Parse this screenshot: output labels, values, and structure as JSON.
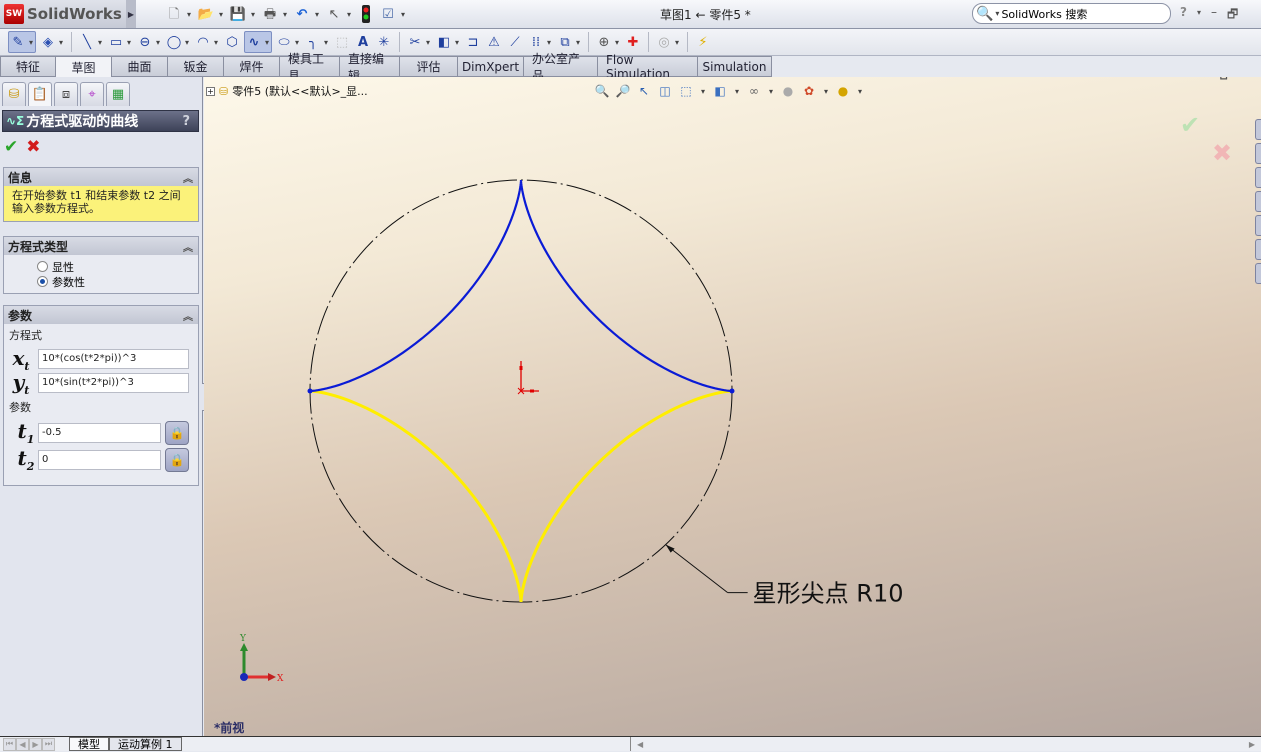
{
  "app": {
    "logo_mark": "SW",
    "logo_text": "SolidWorks",
    "document_title": "草图1 ← 零件5 *",
    "search_placeholder": "SolidWorks 搜索"
  },
  "quick_access": [
    {
      "name": "new-document-icon",
      "glyph": "🗋"
    },
    {
      "name": "open-folder-icon",
      "glyph": "📂"
    },
    {
      "name": "save-icon",
      "glyph": "💾"
    },
    {
      "name": "print-icon",
      "glyph": "🖶"
    },
    {
      "name": "undo-icon",
      "glyph": "↶"
    },
    {
      "name": "select-pointer-icon",
      "glyph": "↖"
    },
    {
      "name": "rebuild-traffic-light-icon",
      "glyph": "●"
    },
    {
      "name": "options-checklist-icon",
      "glyph": "☑"
    }
  ],
  "window_controls": {
    "help": "?",
    "minimize": "–",
    "restore": "🗗"
  },
  "sketch_toolbar": [
    {
      "name": "exit-sketch-icon",
      "glyph": "✎",
      "active": true
    },
    {
      "name": "smart-dimension-icon",
      "glyph": "◈"
    },
    {
      "name": "line-icon",
      "glyph": "╲"
    },
    {
      "name": "rectangle-icon",
      "glyph": "▭"
    },
    {
      "name": "slot-icon",
      "glyph": "⊖"
    },
    {
      "name": "circle-icon",
      "glyph": "◯"
    },
    {
      "name": "arc-icon",
      "glyph": "◠"
    },
    {
      "name": "polygon-icon",
      "glyph": "⬡"
    },
    {
      "name": "spline-icon",
      "glyph": "∿",
      "active": true
    },
    {
      "name": "ellipse-icon",
      "glyph": "⬭"
    },
    {
      "name": "fillet-icon",
      "glyph": "╮"
    },
    {
      "name": "plane-icon",
      "glyph": "⬚"
    },
    {
      "name": "text-icon",
      "glyph": "A"
    },
    {
      "name": "point-icon",
      "glyph": "✳"
    },
    {
      "name": "trim-entities-icon",
      "glyph": "✂"
    },
    {
      "name": "convert-entities-icon",
      "glyph": "◧"
    },
    {
      "name": "offset-entities-icon",
      "glyph": "⊐"
    },
    {
      "name": "mirror-entities-icon",
      "glyph": "⚠"
    },
    {
      "name": "extend-icon",
      "glyph": "⟋"
    },
    {
      "name": "linear-pattern-icon",
      "glyph": "⋮⋮"
    },
    {
      "name": "move-entities-icon",
      "glyph": "⧉"
    },
    {
      "name": "display-relations-icon",
      "glyph": "⊕"
    },
    {
      "name": "repair-sketch-icon",
      "glyph": "✚"
    },
    {
      "name": "quick-snaps-icon",
      "glyph": "◎"
    },
    {
      "name": "rapid-sketch-icon",
      "glyph": "⚡"
    }
  ],
  "tabs": [
    {
      "label": "特征",
      "active": false
    },
    {
      "label": "草图",
      "active": true
    },
    {
      "label": "曲面",
      "active": false
    },
    {
      "label": "钣金",
      "active": false
    },
    {
      "label": "焊件",
      "active": false
    },
    {
      "label": "模具工具",
      "active": false
    },
    {
      "label": "直接编辑",
      "active": false
    },
    {
      "label": "评估",
      "active": false
    },
    {
      "label": "DimXpert",
      "active": false
    },
    {
      "label": "办公室产品",
      "active": false
    },
    {
      "label": "Flow Simulation",
      "active": false
    },
    {
      "label": "Simulation",
      "active": false
    }
  ],
  "property_manager": {
    "title": "方程式驱动的曲线",
    "help": "?",
    "info": {
      "heading": "信息",
      "text": "在开始参数 t1 和结束参数 t2 之间输入参数方程式。"
    },
    "equation_type": {
      "heading": "方程式类型",
      "options": [
        {
          "label": "显性",
          "selected": false
        },
        {
          "label": "参数性",
          "selected": true
        }
      ]
    },
    "parameters": {
      "heading": "参数",
      "equation_label": "方程式",
      "x_label": "x",
      "x_sub": "t",
      "x_value": "10*(cos(t*2*pi))^3",
      "y_label": "y",
      "y_sub": "t",
      "y_value": "10*(sin(t*2*pi))^3",
      "param_label": "参数",
      "t1_label": "t",
      "t1_sub": "1",
      "t1_value": "-0.5",
      "t2_label": "t",
      "t2_sub": "2",
      "t2_value": "0"
    }
  },
  "viewport": {
    "tree_text": "零件5  (默认<<默认>_显...",
    "annotation": "星形尖点 R10",
    "view_name": "*前视",
    "axis_x": "X",
    "axis_y": "Y",
    "curve_colors": {
      "active": "#0a1bd6",
      "reference": "#ffee00",
      "circle": "#111111",
      "origin": "#e00000"
    },
    "circle_radius": 10,
    "t_range_active": [
      -0.5,
      0
    ]
  },
  "hud_icons": [
    "zoom-to-fit-icon",
    "zoom-to-area-icon",
    "previous-view-icon",
    "section-view-icon",
    "view-orientation-icon",
    "display-style-icon",
    "hide-show-items-icon",
    "edit-appearance-icon",
    "apply-scene-icon",
    "view-settings-icon"
  ],
  "bottom_tabs": [
    {
      "label": "模型",
      "active": true
    },
    {
      "label": "运动算例 1",
      "active": false
    }
  ]
}
